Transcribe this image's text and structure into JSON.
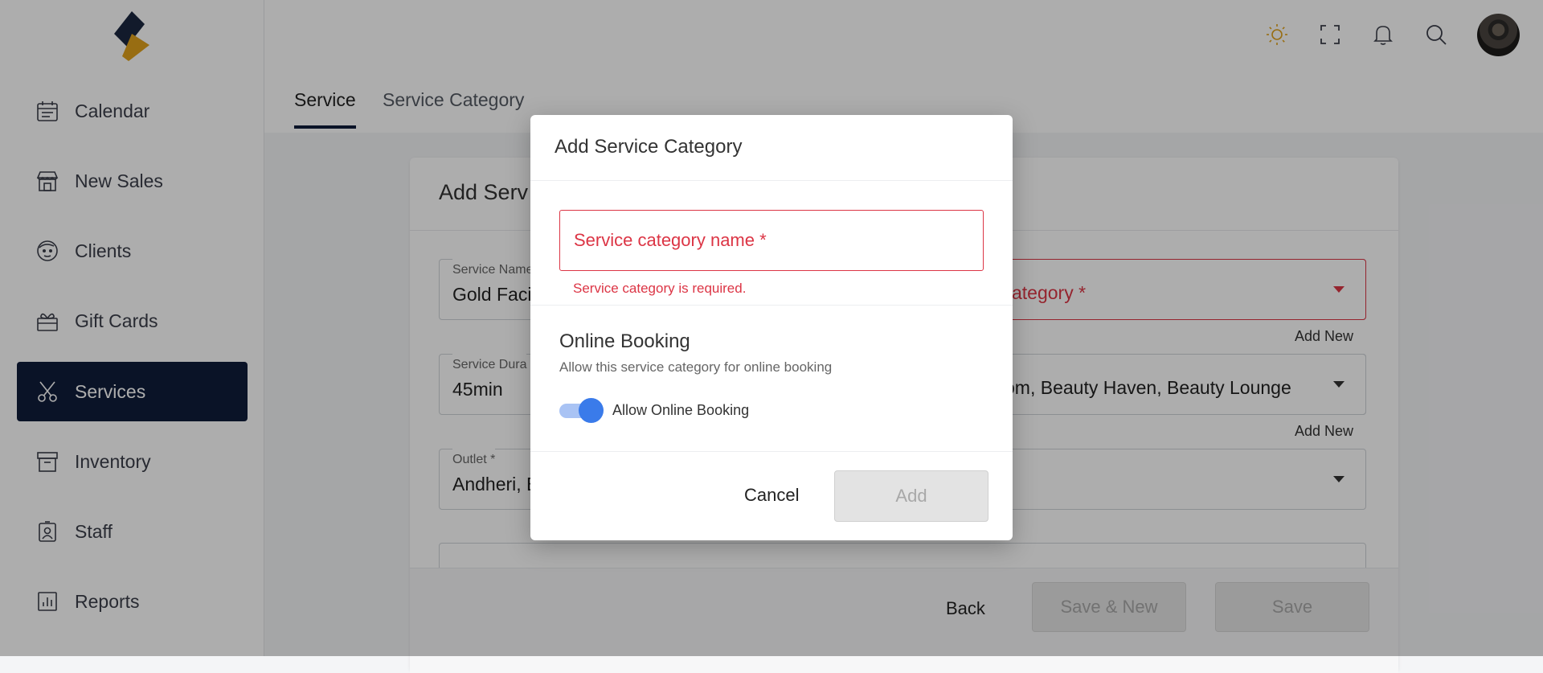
{
  "sidebar": {
    "items": [
      {
        "label": "Calendar",
        "icon": "calendar-icon"
      },
      {
        "label": "New Sales",
        "icon": "storefront-icon"
      },
      {
        "label": "Clients",
        "icon": "face-icon"
      },
      {
        "label": "Gift Cards",
        "icon": "gift-icon"
      },
      {
        "label": "Services",
        "icon": "scissors-icon",
        "active": true
      },
      {
        "label": "Inventory",
        "icon": "archive-icon"
      },
      {
        "label": "Staff",
        "icon": "id-badge-icon"
      },
      {
        "label": "Reports",
        "icon": "bar-chart-icon"
      }
    ]
  },
  "header": {
    "icons": [
      "sun-icon",
      "fullscreen-icon",
      "bell-icon",
      "search-icon"
    ],
    "accent_color": "#e0a11b"
  },
  "tabs": [
    {
      "label": "Service",
      "active": true
    },
    {
      "label": "Service Category",
      "active": false
    }
  ],
  "card": {
    "title_visible": "Add Serv",
    "service_name": {
      "label": "Service Name",
      "value_visible": "Gold Facia"
    },
    "category_placeholder_visible": "ategory *",
    "add_new_1": "Add New",
    "service_duration": {
      "label_visible": "Service Dura",
      "value": "45min"
    },
    "locations_visible": "om, Beauty Haven, Beauty Lounge",
    "add_new_2": "Add New",
    "outlet": {
      "label": "Outlet *",
      "value_visible": "Andheri, B"
    },
    "footer": {
      "back": "Back",
      "save_new": "Save & New",
      "save": "Save"
    }
  },
  "modal": {
    "title": "Add Service Category",
    "input_placeholder": "Service category name *",
    "error": "Service category is required.",
    "online_booking_title": "Online Booking",
    "online_booking_desc": "Allow this service category for online booking",
    "toggle_label": "Allow Online Booking",
    "toggle_on": true,
    "cancel": "Cancel",
    "add": "Add"
  },
  "colors": {
    "primary_dark": "#101d3a",
    "error": "#dc3545",
    "toggle_blue": "#3a7bea"
  }
}
